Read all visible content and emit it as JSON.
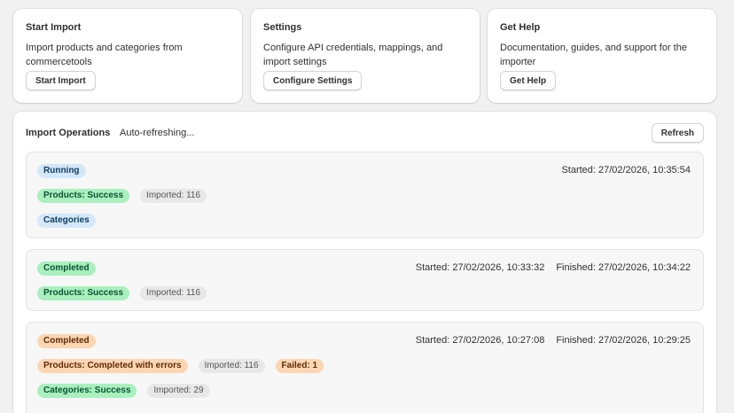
{
  "cards": [
    {
      "title": "Start Import",
      "description": "Import products and categories from commercetools",
      "button": "Start Import"
    },
    {
      "title": "Settings",
      "description": "Configure API credentials, mappings, and import settings",
      "button": "Configure Settings"
    },
    {
      "title": "Get Help",
      "description": "Documentation, guides, and support for the importer",
      "button": "Get Help"
    }
  ],
  "operations": {
    "title": "Import Operations",
    "status": "Auto-refreshing...",
    "refresh_label": "Refresh",
    "items": [
      {
        "status": "Running",
        "started": "Started: 27/02/2026, 10:35:54",
        "products_badge": "Products: Success",
        "products_imported": "Imported: 116",
        "categories_badge": "Categories"
      },
      {
        "status": "Completed",
        "started": "Started: 27/02/2026, 10:33:32",
        "finished": "Finished: 27/02/2026, 10:34:22",
        "products_badge": "Products: Success",
        "products_imported": "Imported: 116"
      },
      {
        "status": "Completed",
        "started": "Started: 27/02/2026, 10:27:08",
        "finished": "Finished: 27/02/2026, 10:29:25",
        "products_badge": "Products: Completed with errors",
        "products_imported": "Imported: 116",
        "products_failed": "Failed: 1",
        "categories_badge": "Categories: Success",
        "categories_imported": "Imported: 29"
      }
    ]
  },
  "colors": {
    "background": "#f1f1f1",
    "info_badge": "#d4e8f9",
    "success_badge": "#a9f0be",
    "warning_badge": "#fcd6b3",
    "neutral_badge": "#e8e8e8"
  }
}
